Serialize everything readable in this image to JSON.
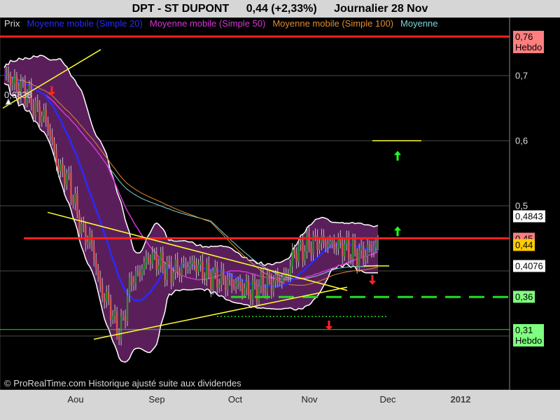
{
  "header": {
    "ticker": "DPT - ST DUPONT",
    "quote": "0,44 (+2,33%)",
    "period": "Journalier  28 Nov"
  },
  "legend": {
    "items": [
      {
        "label": "Prix",
        "color": "#d9d9d9"
      },
      {
        "label": "Moyenne mobile (Simple 20)",
        "color": "#2a2aff"
      },
      {
        "label": "Moyenne mobile (Simple 50)",
        "color": "#d633d6"
      },
      {
        "label": "Moyenne mobile (Simple 100)",
        "color": "#e08a2e"
      },
      {
        "label": "Moyenne",
        "color": "#7fd6d6"
      }
    ]
  },
  "footer": {
    "copyright": "© ProRealTime.com Historique ajusté suite aux dividendes"
  },
  "annotations": {
    "start_price_label": "0,6838"
  },
  "chart_data": {
    "type": "candlestick",
    "x_ticks": [
      "Aou",
      "Sep",
      "Oct",
      "Nov",
      "Dec",
      "2012"
    ],
    "y_ticks": [
      "0,7",
      "0,6",
      "0,5"
    ],
    "ylim": [
      0.275,
      0.785
    ],
    "price_tags": [
      {
        "value": 0.76,
        "label": "0,76",
        "sub": "Hebdo",
        "bg": "#ff7f7f"
      },
      {
        "value": 0.4843,
        "label": "0,4843",
        "bg": "#ffffff"
      },
      {
        "value": 0.45,
        "label": "0,45",
        "bg": "#ff7f7f"
      },
      {
        "value": 0.44,
        "label": "0,44",
        "bg": "#ffcc00"
      },
      {
        "value": 0.4076,
        "label": "0,4076",
        "bg": "#ffffff"
      },
      {
        "value": 0.36,
        "label": "0,36",
        "bg": "#7fff7f"
      },
      {
        "value": 0.31,
        "label": "0,31",
        "sub": "Hebdo",
        "bg": "#7fff7f"
      }
    ],
    "horizontal_lines": [
      {
        "value": 0.76,
        "color": "#ff2020",
        "style": "solid"
      },
      {
        "value": 0.45,
        "color": "#ff2020",
        "style": "solid"
      },
      {
        "value": 0.36,
        "color": "#22dd22",
        "style": "dashed"
      },
      {
        "value": 0.31,
        "color": "#22dd22",
        "style": "thin"
      }
    ],
    "price_start": 0.6838,
    "price_low": 0.3,
    "price_last": 0.44,
    "grid": true
  },
  "colors": {
    "background": "#000000",
    "axis_panel": "#d6d6d6",
    "bollinger_fill": "#5a1f5a",
    "bollinger_edge": "#ffffff",
    "candle_up": "#2e8b2e",
    "candle_down": "#d9534f",
    "trendline": "#ffff33",
    "arrow_up": "#22ff22",
    "arrow_down": "#ff2222"
  }
}
